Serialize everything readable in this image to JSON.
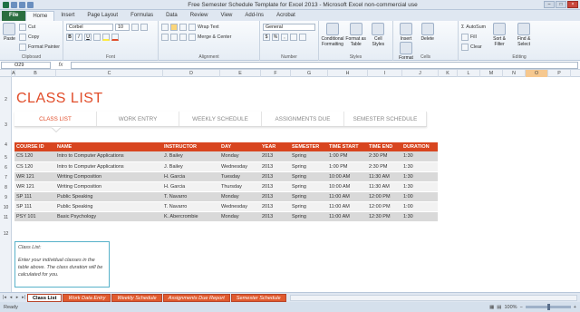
{
  "window": {
    "title": "Free Semester Schedule Template for Excel 2013  -  Microsoft Excel non-commercial use"
  },
  "ribbon_tabs": [
    "File",
    "Home",
    "Insert",
    "Page Layout",
    "Formulas",
    "Data",
    "Review",
    "View",
    "Add-Ins",
    "Acrobat"
  ],
  "ribbon": {
    "clipboard": {
      "paste": "Paste",
      "cut": "Cut",
      "copy": "Copy",
      "format_painter": "Format Painter",
      "label": "Clipboard"
    },
    "font": {
      "name": "Corbel",
      "size": "10",
      "label": "Font"
    },
    "alignment": {
      "wrap": "Wrap Text",
      "merge": "Merge & Center",
      "label": "Alignment"
    },
    "number": {
      "format": "General",
      "label": "Number"
    },
    "styles": {
      "cond": "Conditional Formatting",
      "table": "Format as Table",
      "cell": "Cell Styles",
      "label": "Styles"
    },
    "cells": {
      "insert": "Insert",
      "delete": "Delete",
      "format": "Format",
      "label": "Cells"
    },
    "editing": {
      "autosum": "AutoSum",
      "fill": "Fill",
      "clear": "Clear",
      "sort": "Sort & Filter",
      "find": "Find & Select",
      "label": "Editing"
    }
  },
  "formula_bar": {
    "name_box": "O29",
    "fx": "fx",
    "value": ""
  },
  "columns": [
    "A",
    "B",
    "C",
    "D",
    "E",
    "F",
    "G",
    "H",
    "I",
    "J",
    "K",
    "L",
    "M",
    "N",
    "O",
    "P"
  ],
  "rows": [
    "1",
    "2",
    "3",
    "4",
    "5",
    "6",
    "7",
    "8",
    "9",
    "10",
    "11",
    "12",
    "13",
    "14",
    "15",
    "16"
  ],
  "page": {
    "title": "CLASS LIST",
    "nav": [
      "CLASS LIST",
      "WORK ENTRY",
      "WEEKLY SCHEDULE",
      "ASSIGNMENTS DUE",
      "SEMESTER SCHEDULE"
    ]
  },
  "table": {
    "headers": [
      "COURSE ID",
      "NAME",
      "INSTRUCTOR",
      "DAY",
      "YEAR",
      "SEMESTER",
      "TIME START",
      "TIME END",
      "DURATION"
    ],
    "rows": [
      [
        "CS 120",
        "Intro to Computer Applications",
        "J. Bailey",
        "Monday",
        "2013",
        "Spring",
        "1:00 PM",
        "2:30 PM",
        "1:30"
      ],
      [
        "CS 120",
        "Intro to Computer Applications",
        "J. Bailey",
        "Wednesday",
        "2013",
        "Spring",
        "1:00 PM",
        "2:30 PM",
        "1:30"
      ],
      [
        "WR 121",
        "Writing Composition",
        "H. Garcia",
        "Tuesday",
        "2013",
        "Spring",
        "10:00 AM",
        "11:30 AM",
        "1:30"
      ],
      [
        "WR 121",
        "Writing Composition",
        "H. Garcia",
        "Thursday",
        "2013",
        "Spring",
        "10:00 AM",
        "11:30 AM",
        "1:30"
      ],
      [
        "SP 111",
        "Public Speaking",
        "T. Navarro",
        "Monday",
        "2013",
        "Spring",
        "11:00 AM",
        "12:00 PM",
        "1:00"
      ],
      [
        "SP 111",
        "Public Speaking",
        "T. Navarro",
        "Wednesday",
        "2013",
        "Spring",
        "11:00 AM",
        "12:00 PM",
        "1:00"
      ],
      [
        "PSY 101",
        "Basic Psychology",
        "K. Abercrombie",
        "Monday",
        "2013",
        "Spring",
        "11:00 AM",
        "12:30 PM",
        "1:30"
      ]
    ]
  },
  "note": {
    "title": "Class List:",
    "body": "Enter your individual classes in the table above. The class duration will be calculated for you."
  },
  "sheet_tabs": [
    "Class List",
    "Work Data Entry",
    "Weekly Schedule",
    "Assignments Due Report",
    "Semester Schedule"
  ],
  "status": {
    "ready": "Ready",
    "zoom": "100%"
  },
  "colors": {
    "accent": "#e14d2a",
    "header": "#d8451f",
    "note_border": "#57b1c9"
  }
}
